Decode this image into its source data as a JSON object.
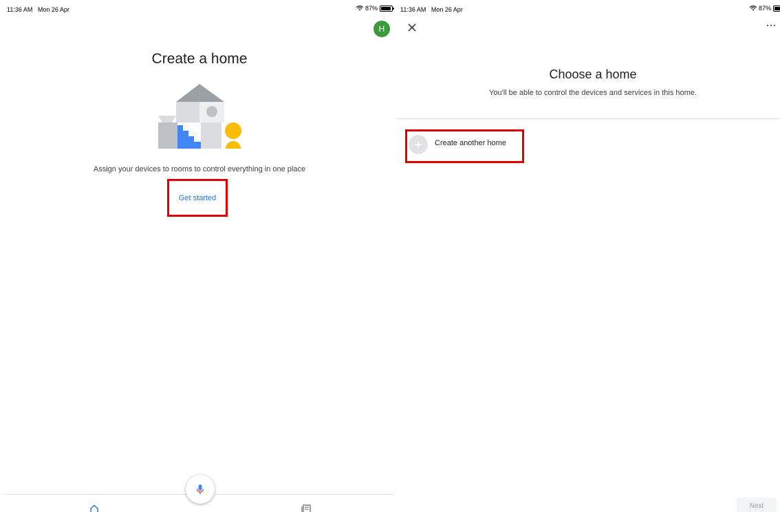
{
  "left": {
    "status": {
      "time": "11:36 AM",
      "date": "Mon 26 Apr",
      "battery": "87%"
    },
    "avatar_initial": "H",
    "title": "Create a home",
    "description": "Assign your devices to rooms to control everything in one place",
    "get_started_label": "Get started",
    "icons": {
      "mic": "mic-icon",
      "home_tab": "home-icon",
      "feed_tab": "feed-icon",
      "avatar": "avatar"
    }
  },
  "right": {
    "status": {
      "time": "11:36 AM",
      "date": "Mon 26 Apr",
      "battery": "87%"
    },
    "title": "Choose a home",
    "subtitle": "You'll be able to control the devices and services in this home.",
    "create_label": "Create another home",
    "next_label": "Next",
    "icons": {
      "close": "close-icon",
      "more": "more-icon",
      "plus": "plus-icon"
    }
  },
  "colors": {
    "link": "#1a73e8",
    "avatar": "#3d9a3a",
    "highlight": "#e00000",
    "illustration_blue": "#4285f4",
    "illustration_yellow": "#fbbc04",
    "illustration_grey": "#bdc1c6"
  }
}
